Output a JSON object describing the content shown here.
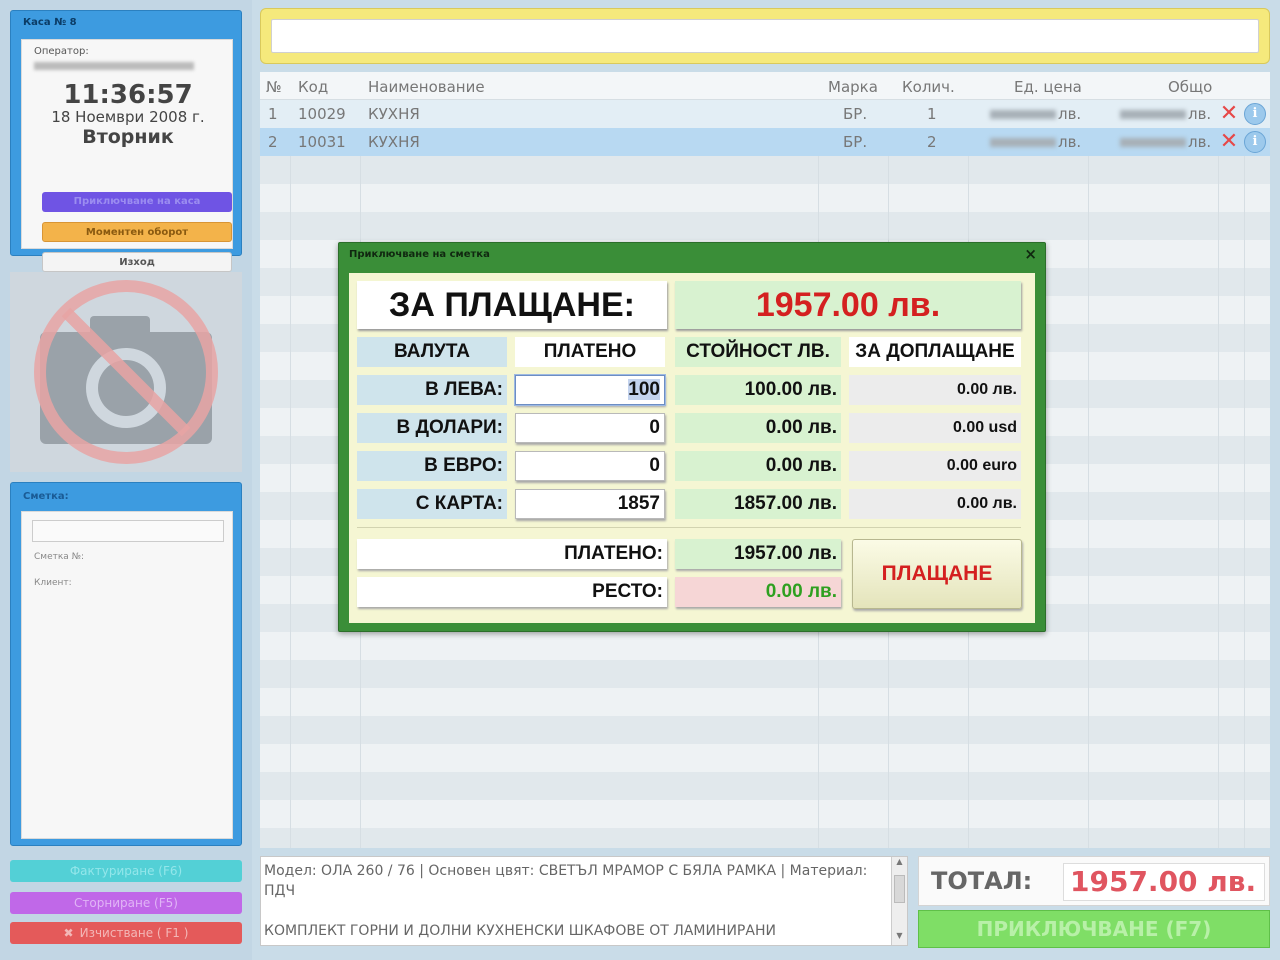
{
  "sidebar": {
    "cashbox_title": "Каса № 8",
    "operator_label": "Оператор:",
    "clock": "11:36:57",
    "date": "18 Ноември 2008 г.",
    "weekday": "Вторник",
    "close_register_button": "Приключване на каса",
    "turnover_button": "Моментен оборот",
    "exit_button": "Изход",
    "bill_title": "Сметка:",
    "bill_number_label": "Сметка №:",
    "client_label": "Клиент:",
    "invoice_button": "Фактуриране (F6)",
    "storno_button": "Сторниране (F5)",
    "clear_button": "Изчистване ( F1 )"
  },
  "table": {
    "headers": [
      "№",
      "Код",
      "Наименование",
      "Марка",
      "Колич.",
      "Ед. цена",
      "Общо"
    ],
    "rows": [
      {
        "num": "1",
        "code": "10029",
        "name": "КУХНЯ",
        "brand": "БР.",
        "qty": "1",
        "unit_suffix": "лв.",
        "total_suffix": "лв."
      },
      {
        "num": "2",
        "code": "10031",
        "name": "КУХНЯ",
        "brand": "БР.",
        "qty": "2",
        "unit_suffix": "лв.",
        "total_suffix": "лв."
      }
    ]
  },
  "description": {
    "text_line1": "Модел: ОЛА 260 / 76 |  Основен цвят: СВЕТЪЛ МРАМОР С БЯЛА РАМКА |  Материал: ПДЧ",
    "text_line2": "КОМПЛЕКТ ГОРНИ И ДОЛНИ КУХНЕНСКИ ШКАФОВЕ ОТ ЛАМИНИРАНИ"
  },
  "total": {
    "label": "ТОТАЛ:",
    "value": "1957.00 лв.",
    "finish_button": "ПРИКЛЮЧВАНЕ (F7)"
  },
  "modal": {
    "title": "Приключване на сметка",
    "close": "×",
    "due_label": "ЗА ПЛАЩАНЕ:",
    "due_value": "1957.00 лв.",
    "headers": [
      "ВАЛУТА",
      "ПЛАТЕНО",
      "СТОЙНОСТ ЛВ.",
      "ЗА ДОПЛАЩАНЕ"
    ],
    "rows": [
      {
        "currency": "В ЛЕВА:",
        "paid": "100",
        "value": "100.00 лв.",
        "remaining": "0.00 лв."
      },
      {
        "currency": "В ДОЛАРИ:",
        "paid": "0",
        "value": "0.00 лв.",
        "remaining": "0.00 usd"
      },
      {
        "currency": "В ЕВРО:",
        "paid": "0",
        "value": "0.00 лв.",
        "remaining": "0.00 euro"
      },
      {
        "currency": "С КАРТА:",
        "paid": "1857",
        "value": "1857.00 лв.",
        "remaining": "0.00 лв."
      }
    ],
    "paid_label": "ПЛАТЕНО:",
    "paid_value": "1957.00 лв.",
    "change_label": "РЕСТО:",
    "change_value": "0.00 лв.",
    "pay_button": "ПЛАЩАНЕ"
  },
  "colors": {
    "modal_frame": "#3a8e38",
    "amount_red": "#d42020",
    "change_green": "#2ea020",
    "topbar_yellow": "#f5e97c",
    "selected_row": "#b8d9f2"
  },
  "icons": [
    "camera-disabled-icon",
    "delete-x-icon",
    "info-icon",
    "close-icon",
    "scroll-up-icon",
    "scroll-down-icon"
  ]
}
